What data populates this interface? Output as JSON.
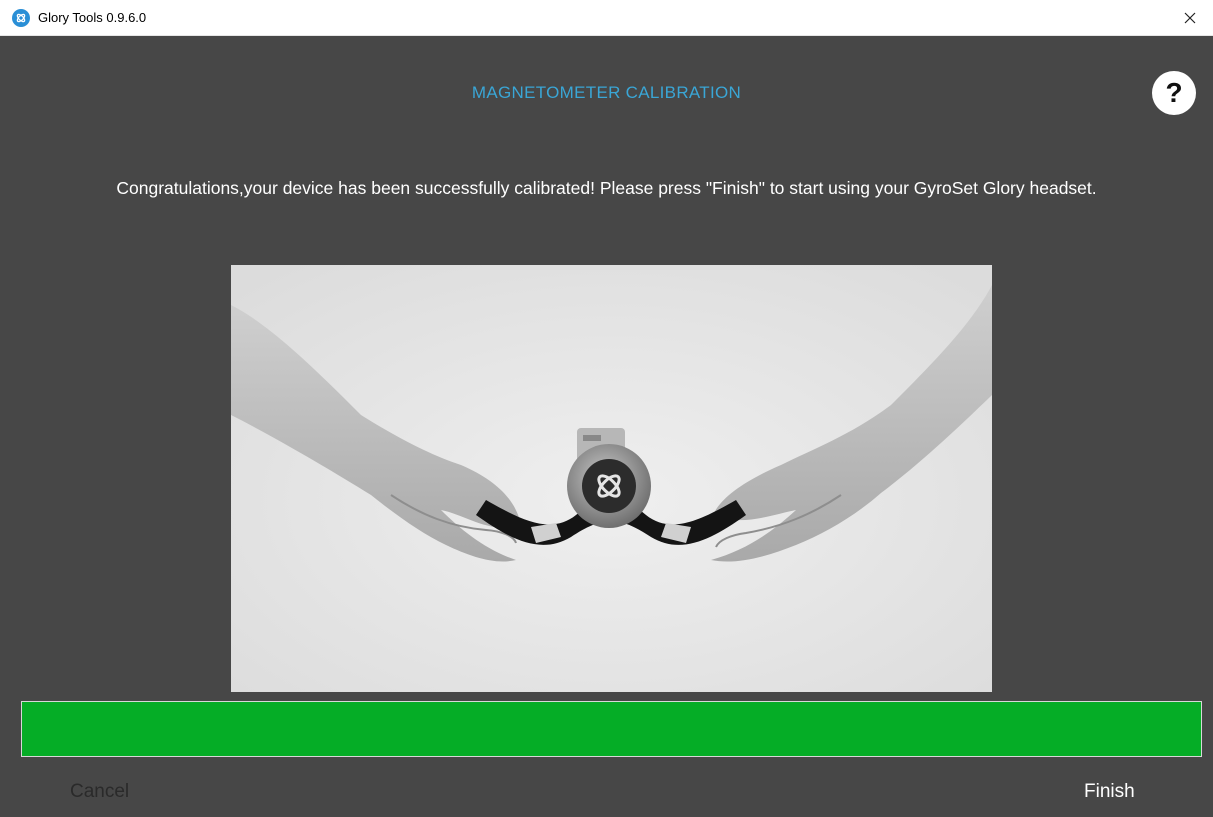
{
  "window": {
    "title": "Glory Tools 0.9.6.0",
    "icon": "glory-tools-app-icon",
    "close_icon": "close-icon"
  },
  "header": {
    "title": "MAGNETOMETER CALIBRATION",
    "title_color": "#3aa6d6",
    "help_label": "?"
  },
  "message": "Congratulations,your device has been successfully calibrated! Please press \"Finish\" to start using your GyroSet Glory headset.",
  "illustration": {
    "icon": "hands-holding-headset-photo"
  },
  "progress": {
    "value": 100,
    "fill_color": "#05ad26"
  },
  "footer": {
    "cancel_label": "Cancel",
    "finish_label": "Finish"
  },
  "colors": {
    "background": "#474747",
    "accent": "#3aa6d6"
  }
}
